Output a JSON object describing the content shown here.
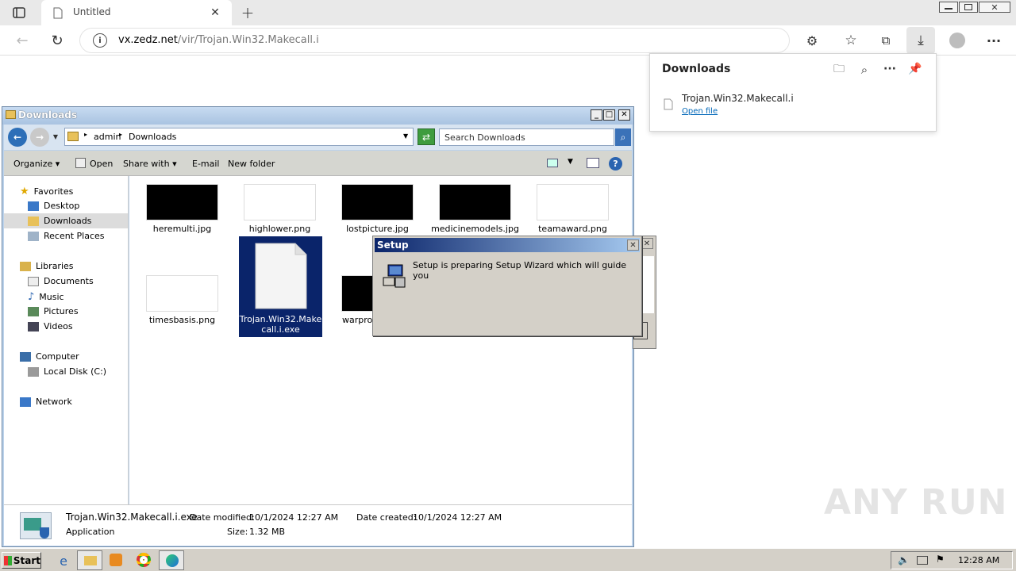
{
  "browser": {
    "tab_title": "Untitled",
    "url_host": "vx.zedz.net",
    "url_path": "/vir/Trojan.Win32.Makecall.i",
    "icons": [
      "tab-actions-icon",
      "page-icon",
      "close-icon",
      "new-tab-icon",
      "back-icon",
      "reload-icon",
      "info-icon",
      "add-favorite-icon",
      "extensions-icon",
      "favorites-icon",
      "collections-icon",
      "downloads-icon",
      "profile-icon",
      "more-icon"
    ]
  },
  "downloads_panel": {
    "title": "Downloads",
    "item_name": "Trojan.Win32.Makecall.i",
    "item_action": "Open file"
  },
  "explorer": {
    "title": "Downloads",
    "breadcrumb": [
      "admin",
      "Downloads"
    ],
    "search_placeholder": "Search Downloads",
    "commands": {
      "organize": "Organize",
      "open": "Open",
      "share_with": "Share with",
      "email": "E-mail",
      "new_folder": "New folder"
    },
    "nav": {
      "favorites": "Favorites",
      "desktop": "Desktop",
      "downloads": "Downloads",
      "recent_places": "Recent Places",
      "libraries": "Libraries",
      "documents": "Documents",
      "music": "Music",
      "pictures": "Pictures",
      "videos": "Videos",
      "computer": "Computer",
      "local_disk": "Local Disk (C:)",
      "network": "Network"
    },
    "files": [
      {
        "name": "heremulti.jpg",
        "thumb": "dark"
      },
      {
        "name": "highlower.png",
        "thumb": "light"
      },
      {
        "name": "lostpicture.jpg",
        "thumb": "dark"
      },
      {
        "name": "medicinemodels.jpg",
        "thumb": "dark"
      },
      {
        "name": "teamaward.png",
        "thumb": "light"
      },
      {
        "name": "timesbasis.png",
        "thumb": "light"
      },
      {
        "name": "Trojan.Win32.Make call.i.exe",
        "line1": "Trojan.Win32.Make",
        "line2": "call.i.exe",
        "selected": true
      },
      {
        "name": "warpro",
        "thumb": "dark"
      }
    ],
    "status": {
      "filename": "Trojan.Win32.Makecall.i.exe",
      "type": "Application",
      "modified_label": "Date modified:",
      "modified": "10/1/2024 12:27 AM",
      "created_label": "Date created:",
      "created": "10/1/2024 12:27 AM",
      "size_label": "Size:",
      "size": "1.32 MB"
    }
  },
  "setup_dialog": {
    "title": "Setup",
    "message": "Setup is preparing Setup Wizard which will guide you"
  },
  "taskbar": {
    "start": "Start",
    "clock": "12:28 AM"
  },
  "watermark": "ANY RUN",
  "colors": {
    "selection": "#0a246a",
    "titlebar": "#a9c3e1",
    "link": "#0067b8"
  }
}
